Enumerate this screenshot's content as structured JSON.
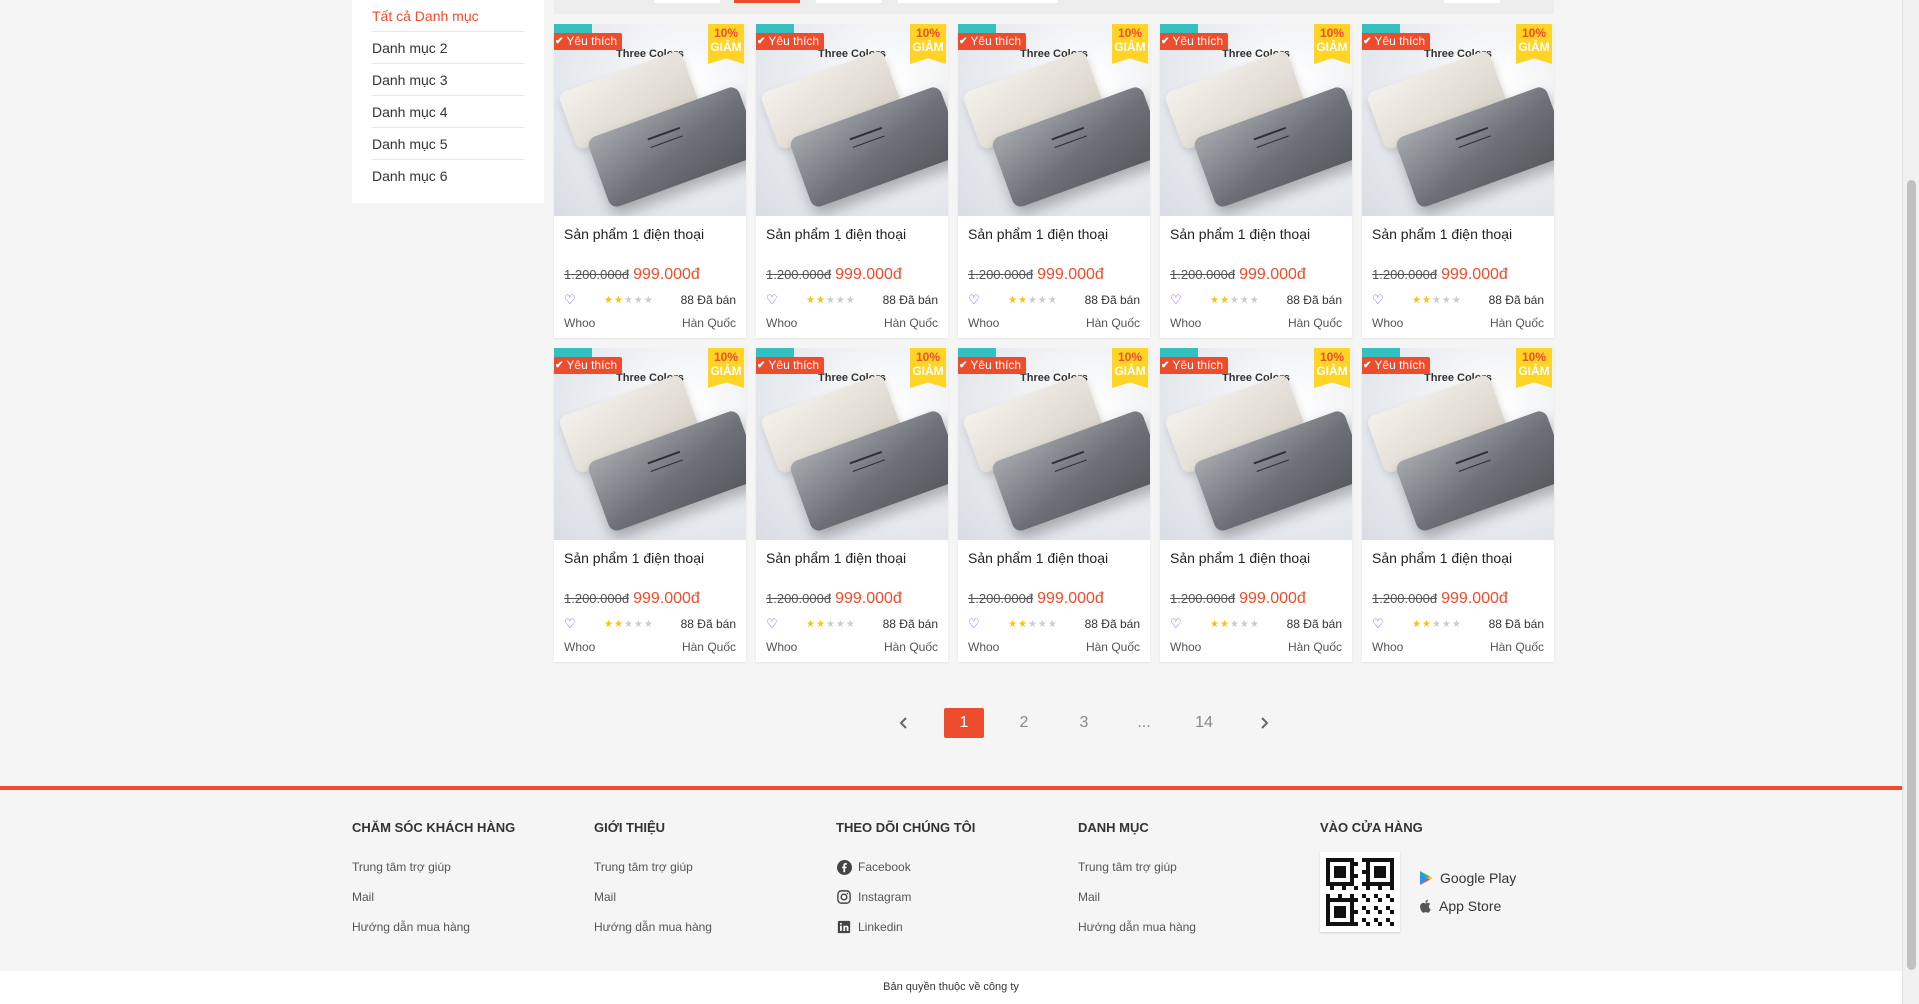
{
  "sidebar": {
    "categories": [
      "Tất cả Danh mục",
      "Danh mục 2",
      "Danh mục 3",
      "Danh mục 4",
      "Danh mục 5",
      "Danh mục 6"
    ]
  },
  "product": {
    "badge_fav": "Yêu thích",
    "discount_pct": "10%",
    "discount_label": "GIẢM",
    "image_caption": "Three Colors",
    "name": "Sản phẩm 1 điện thoại",
    "old_price": "1.200.000đ",
    "new_price": "999.000đ",
    "rating_stars": 2,
    "sold": "88 Đã bán",
    "brand": "Whoo",
    "origin": "Hàn Quốc"
  },
  "product_count": 10,
  "pagination": {
    "pages": [
      "1",
      "2",
      "3",
      "...",
      "14"
    ],
    "current": "1"
  },
  "footer": {
    "customer_care": {
      "title": "CHĂM SÓC KHÁCH HÀNG",
      "links": [
        "Trung tâm trợ giúp",
        "Mail",
        "Hướng dẫn mua hàng"
      ]
    },
    "about": {
      "title": "GIỚI THIỆU",
      "links": [
        "Trung tâm trợ giúp",
        "Mail",
        "Hướng dẫn mua hàng"
      ]
    },
    "follow": {
      "title": "THEO DÕI CHÚNG TÔI",
      "links": [
        {
          "label": "Facebook",
          "icon": "facebook-icon"
        },
        {
          "label": "Instagram",
          "icon": "instagram-icon"
        },
        {
          "label": "Linkedin",
          "icon": "linkedin-icon"
        }
      ]
    },
    "categories": {
      "title": "DANH MỤC",
      "links": [
        "Trung tâm trợ giúp",
        "Mail",
        "Hướng dẫn mua hàng"
      ]
    },
    "store": {
      "title": "VÀO CỬA HÀNG",
      "google_play": "Google Play",
      "app_store": "App Store"
    },
    "copyright": "Bản quyền thuộc về công ty"
  },
  "colors": {
    "accent": "#ee4d2d",
    "discount_badge": "#ffd424",
    "heart": "#7c3aed",
    "star": "#ffc107"
  }
}
